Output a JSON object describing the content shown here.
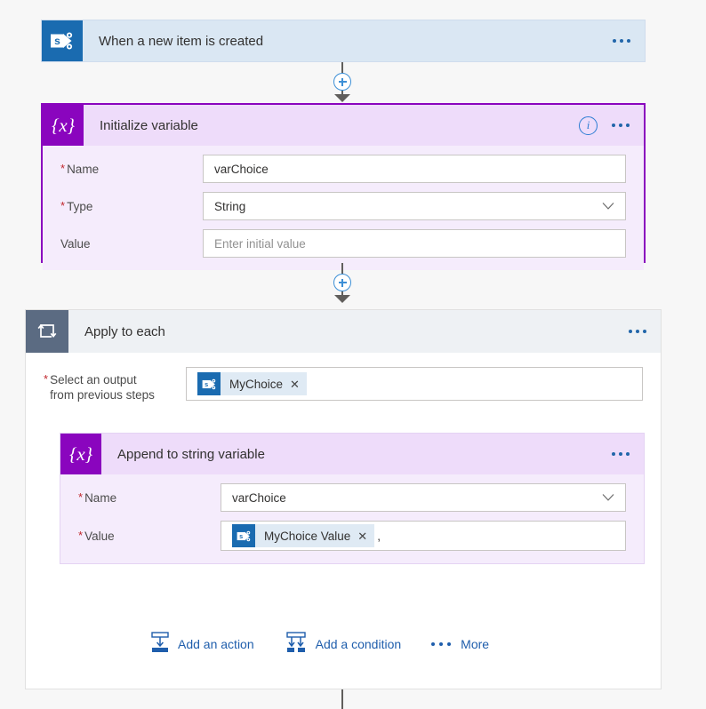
{
  "flow": {
    "trigger": {
      "title": "When a new item is created",
      "icon": "sharepoint-icon",
      "accent": "#1a6bb0",
      "background": "#dae7f3"
    },
    "initialize_variable": {
      "title": "Initialize variable",
      "icon": "variable-icon",
      "icon_glyph": "{x}",
      "accent": "#8a05be",
      "selected": true,
      "info_label": "i",
      "menu_label": "•••",
      "fields": [
        {
          "label": "Name",
          "required": true,
          "value": "varChoice",
          "type": "text",
          "placeholder": ""
        },
        {
          "label": "Type",
          "required": true,
          "value": "String",
          "type": "dropdown",
          "placeholder": ""
        },
        {
          "label": "Value",
          "required": false,
          "value": "",
          "type": "text",
          "placeholder": "Enter initial value"
        }
      ]
    },
    "apply_to_each": {
      "title": "Apply to each",
      "icon": "loop-icon",
      "accent": "#5b6b82",
      "menu_label": "•••",
      "output_field": {
        "label_line1": "Select an output",
        "label_line2": "from previous steps",
        "required": true,
        "token": {
          "label": "MyChoice",
          "icon": "sharepoint-icon",
          "remove_label": "✕"
        }
      },
      "append_variable": {
        "title": "Append to string variable",
        "icon": "variable-icon",
        "icon_glyph": "{x}",
        "accent": "#8a05be",
        "menu_label": "•••",
        "fields": [
          {
            "label": "Name",
            "required": true,
            "value": "varChoice",
            "type": "dropdown"
          },
          {
            "label": "Value",
            "required": true,
            "type": "token",
            "token": {
              "label": "MyChoice Value",
              "icon": "sharepoint-icon",
              "remove_label": "✕"
            },
            "trailing_text": ","
          }
        ]
      },
      "actions": [
        {
          "label": "Add an action",
          "icon": "add-action-icon"
        },
        {
          "label": "Add a condition",
          "icon": "add-condition-icon"
        },
        {
          "label": "More",
          "icon": "ellipsis-icon"
        }
      ]
    }
  }
}
